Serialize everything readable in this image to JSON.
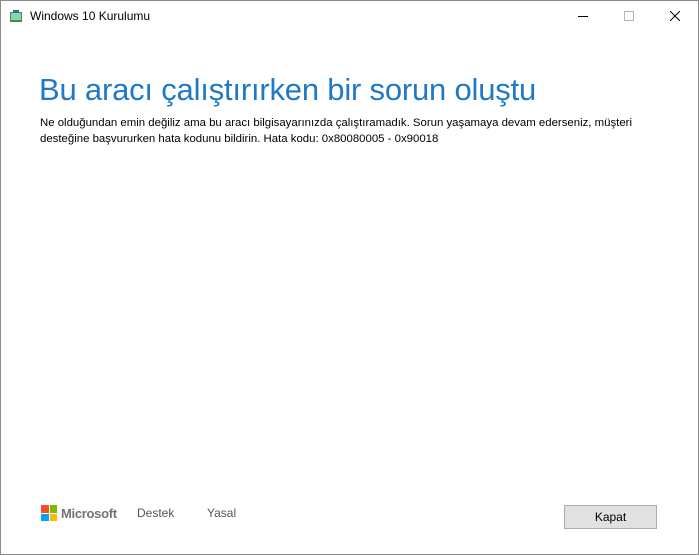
{
  "window": {
    "title": "Windows 10 Kurulumu",
    "icon": "windows-setup-icon"
  },
  "caption_buttons": {
    "minimize_icon": "minimize-icon",
    "maximize_icon": "maximize-icon",
    "close_icon": "close-icon"
  },
  "main": {
    "heading": "Bu aracı çalıştırırken bir sorun oluştu",
    "message": "Ne olduğundan emin değiliz ama bu aracı bilgisayarınızda çalıştıramadık. Sorun yaşamaya devam ederseniz, müşteri desteğine başvururken hata kodunu bildirin. Hata kodu: 0x80080005 - 0x90018"
  },
  "footer": {
    "brand": "Microsoft",
    "links": [
      "Destek",
      "Yasal"
    ],
    "close_button_label": "Kapat"
  },
  "colors": {
    "heading": "#1f79c6",
    "ms_red": "#f25022",
    "ms_green": "#7fba00",
    "ms_blue": "#00a4ef",
    "ms_yellow": "#ffb900"
  }
}
